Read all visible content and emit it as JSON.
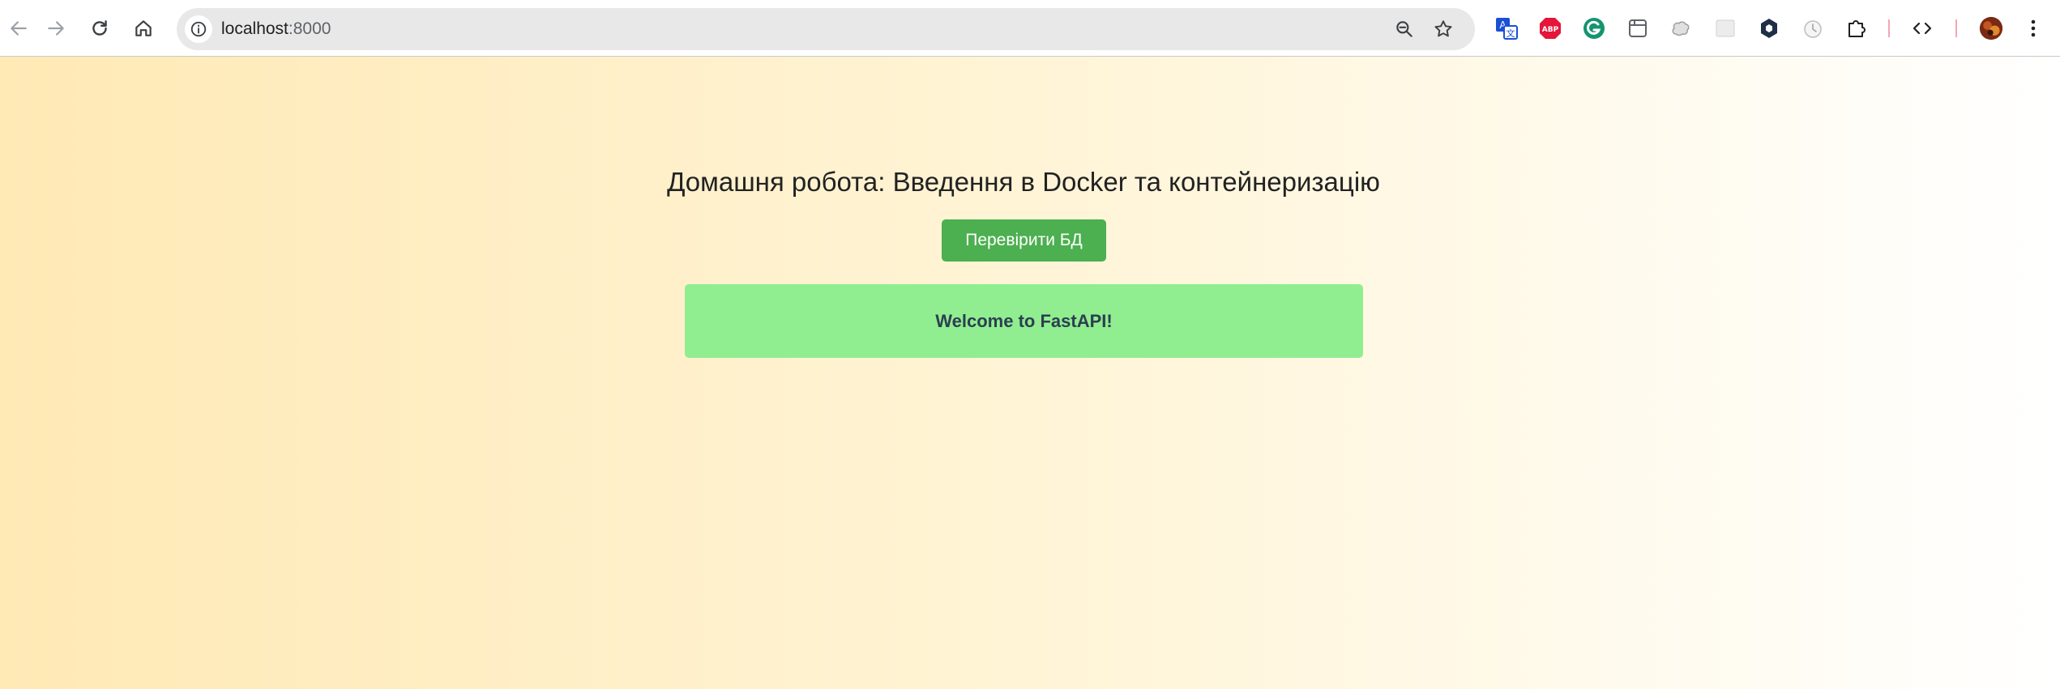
{
  "browser": {
    "url_host": "localhost",
    "url_port": ":8000",
    "nav": {
      "back_icon": "arrow-left-icon",
      "forward_icon": "arrow-right-icon",
      "reload_icon": "reload-icon",
      "home_icon": "home-icon"
    },
    "omnibox_icons": [
      "site-info-icon",
      "zoom-icon",
      "bookmark-star-icon"
    ],
    "extensions": [
      "translate-icon",
      "adblock-plus-icon",
      "grammarly-icon",
      "tab-icon",
      "brain-icon",
      "blank-square-icon",
      "hexagon-icon",
      "clock-icon",
      "puzzle-icon",
      "devtools-icon",
      "avatar",
      "more-menu-icon"
    ],
    "colors": {
      "omnibox_bg": "#e8e8e8",
      "adblock": "#e4143a",
      "grammarly": "#15946e",
      "translate": "#1a4fd6"
    }
  },
  "page": {
    "heading": "Домашня робота: Введення в Docker та контейнеризацію",
    "check_db_button": "Перевірити БД",
    "message": "Welcome to FastAPI!",
    "colors": {
      "button_bg": "#4caf50",
      "message_bg": "#90ee90",
      "message_text": "#2d3e50",
      "gradient_start": "#ffe9b5",
      "gradient_end": "#ffffff"
    }
  }
}
